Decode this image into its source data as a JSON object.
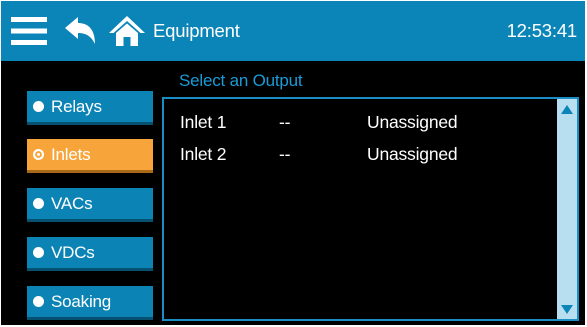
{
  "header": {
    "title": "Equipment",
    "clock": "12:53:41",
    "icons": [
      "menu-icon",
      "back-icon",
      "home-icon"
    ],
    "colors": {
      "bar": "#0b85b8",
      "text": "#ffffff"
    }
  },
  "subheading": "Select an Output",
  "nav": {
    "items": [
      {
        "label": "Relays",
        "selected": false
      },
      {
        "label": "Inlets",
        "selected": true
      },
      {
        "label": "VACs",
        "selected": false
      },
      {
        "label": "VDCs",
        "selected": false
      },
      {
        "label": "Soaking",
        "selected": false
      }
    ],
    "colors": {
      "normal": "#0b84b5",
      "selected": "#f7a53b"
    }
  },
  "outputs": {
    "rows": [
      {
        "name": "Inlet 1",
        "value": "--",
        "status": "Unassigned"
      },
      {
        "name": "Inlet 2",
        "value": "--",
        "status": "Unassigned"
      }
    ]
  },
  "scrollbar": {
    "icons": [
      "scroll-up-icon",
      "scroll-down-icon"
    ],
    "colors": {
      "track": "#b8dff0",
      "arrow": "#0b85b8"
    }
  }
}
